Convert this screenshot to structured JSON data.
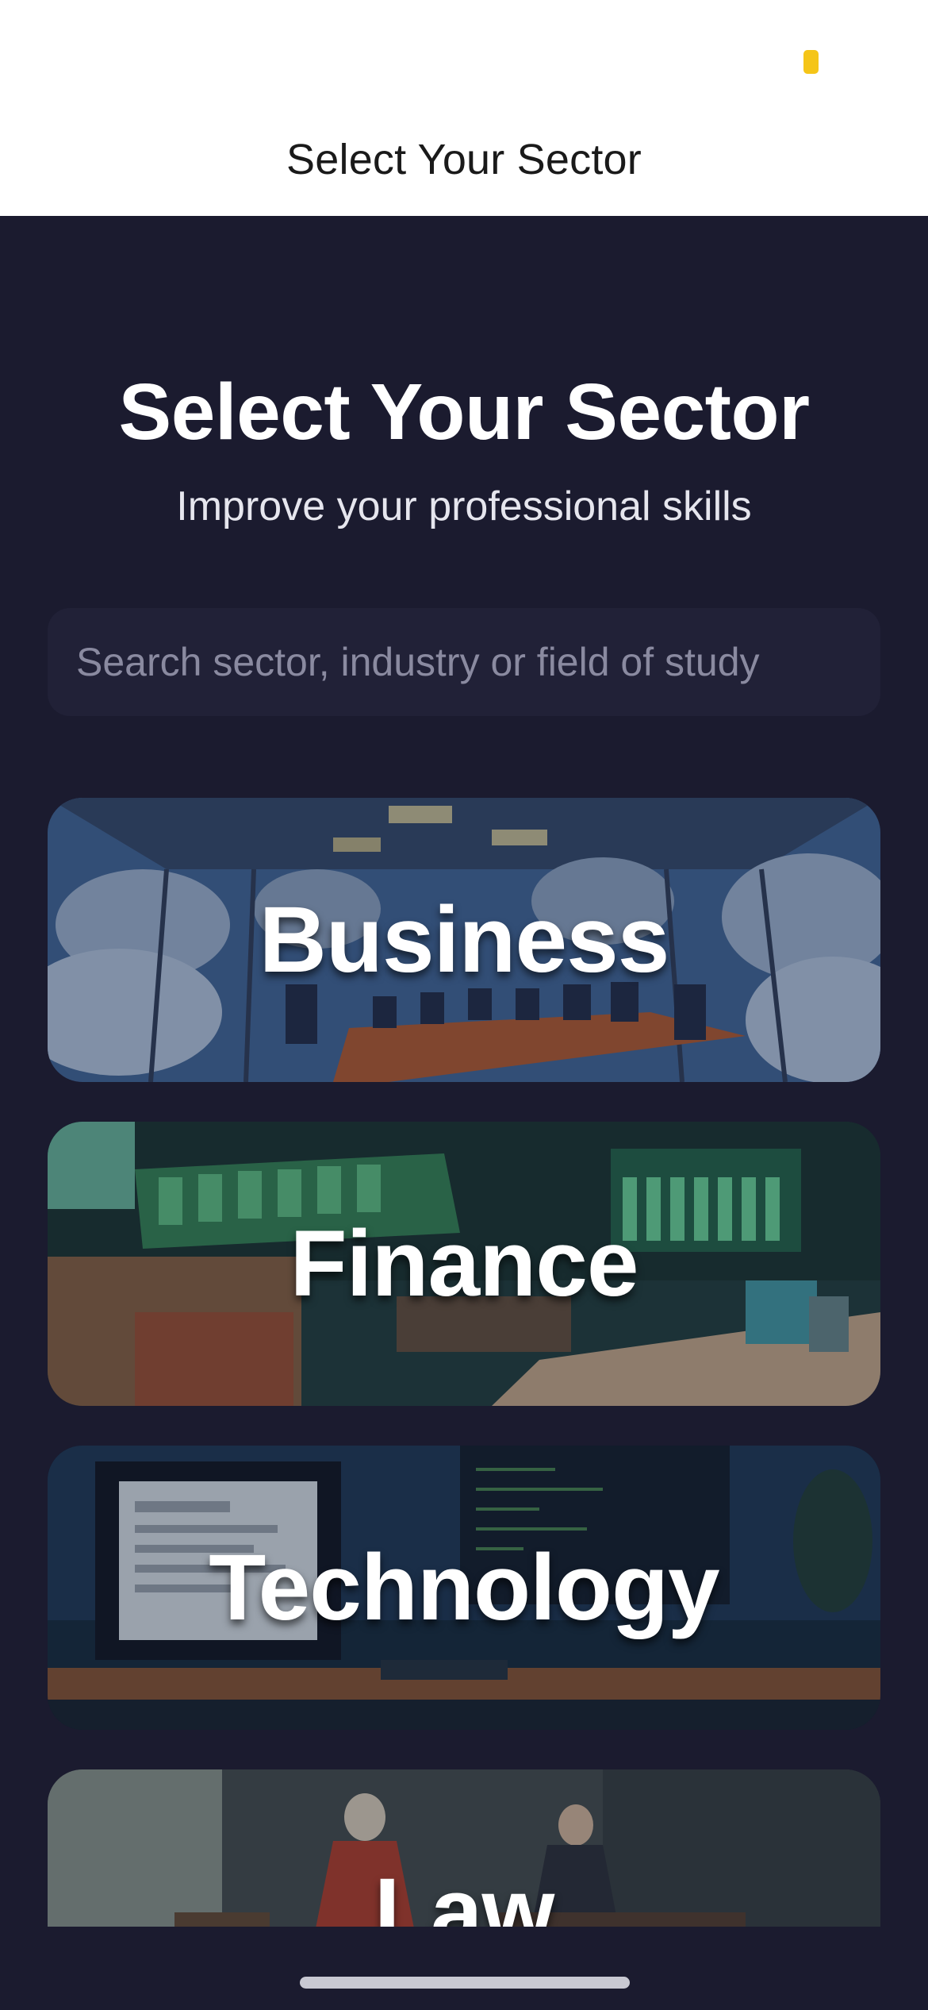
{
  "nav": {
    "title": "Select Your Sector"
  },
  "header": {
    "title": "Select Your Sector",
    "subtitle": "Improve your professional skills"
  },
  "search": {
    "placeholder": "Search sector, industry or field of study",
    "value": ""
  },
  "sectors": [
    {
      "label": "Business",
      "image": "boardroom-illustration"
    },
    {
      "label": "Finance",
      "image": "trading-floor-illustration"
    },
    {
      "label": "Technology",
      "image": "computer-desk-illustration"
    },
    {
      "label": "Law",
      "image": "courtroom-illustration"
    }
  ],
  "colors": {
    "background": "#1b1b2f",
    "navbar": "#ffffff",
    "search_field": "#212137",
    "status_indicator": "#f5c518"
  }
}
